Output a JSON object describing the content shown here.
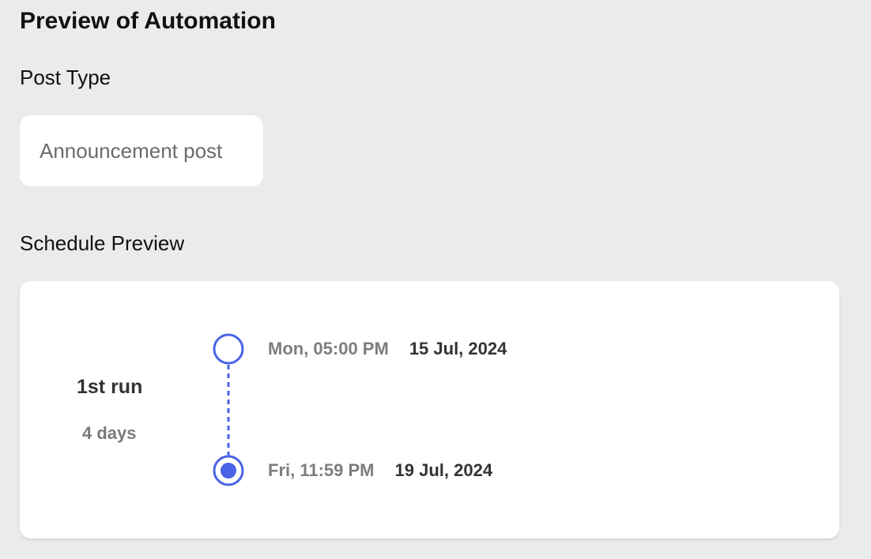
{
  "page": {
    "title": "Preview of Automation"
  },
  "post_type": {
    "label": "Post Type",
    "value": "Announcement post"
  },
  "schedule": {
    "label": "Schedule Preview",
    "run": {
      "title": "1st run",
      "duration": "4 days",
      "start": {
        "time": "Mon, 05:00 PM",
        "date": "15 Jul, 2024"
      },
      "end": {
        "time": "Fri, 11:59 PM",
        "date": "19 Jul, 2024"
      }
    }
  },
  "colors": {
    "accent": "#4a63e6",
    "background": "#eaebed",
    "card": "#ffffff"
  }
}
